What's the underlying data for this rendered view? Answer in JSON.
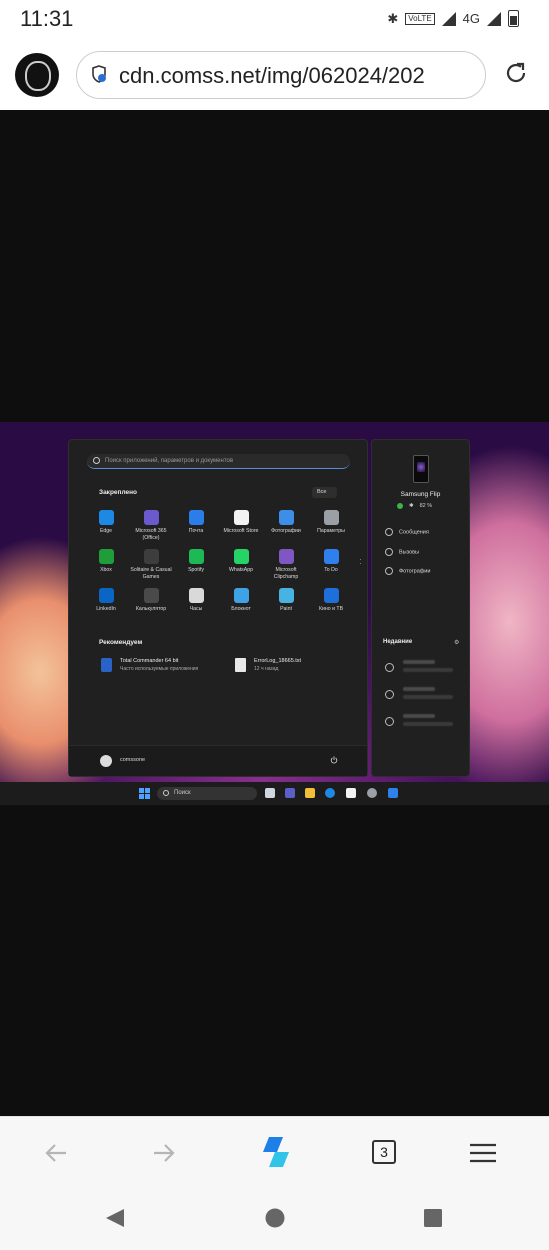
{
  "status_bar": {
    "time": "11:31",
    "volte": "VoLTE",
    "network": "4G"
  },
  "browser": {
    "url": "cdn.comss.net/img/062024/202",
    "tabs_count": "3"
  },
  "start_menu": {
    "search_placeholder": "Поиск приложений, параметров и документов",
    "pinned_title": "Закреплено",
    "all_button": "Все",
    "apps": [
      {
        "label": "Edge",
        "color": "#1e88e5"
      },
      {
        "label": "Microsoft 365 (Office)",
        "color": "#6a5acd"
      },
      {
        "label": "Почта",
        "color": "#2b7de9"
      },
      {
        "label": "Microsoft Store",
        "color": "#f2f2f2"
      },
      {
        "label": "Фотографии",
        "color": "#3d8ee6"
      },
      {
        "label": "Параметры",
        "color": "#9aa0a6"
      },
      {
        "label": "Xbox",
        "color": "#1f9d3a"
      },
      {
        "label": "Solitaire & Casual Games",
        "color": "#3d3d3d"
      },
      {
        "label": "Spotify",
        "color": "#1db954"
      },
      {
        "label": "WhatsApp",
        "color": "#25d366"
      },
      {
        "label": "Microsoft Clipchamp",
        "color": "#7e57c2"
      },
      {
        "label": "To Do",
        "color": "#2f80ed"
      },
      {
        "label": "LinkedIn",
        "color": "#0a66c2"
      },
      {
        "label": "Калькулятор",
        "color": "#4a4a4a"
      },
      {
        "label": "Часы",
        "color": "#d9d9d9"
      },
      {
        "label": "Блокнот",
        "color": "#3fa2e6"
      },
      {
        "label": "Paint",
        "color": "#47b3e0"
      },
      {
        "label": "Кино и ТВ",
        "color": "#1e6fd9"
      }
    ],
    "recommended_title": "Рекомендуем",
    "recommended": [
      {
        "title": "Total Commander 64 bit",
        "subtitle": "Часто используемые приложения",
        "color": "#2a63c8"
      },
      {
        "title": "ErrorLog_18665.txt",
        "subtitle": "12 ч назад",
        "color": "#e8e8e8"
      }
    ],
    "user_name": "comssone"
  },
  "phone_panel": {
    "device_name": "Samsung Flip",
    "battery": "82 %",
    "items": [
      "Сообщения",
      "Вызовы",
      "Фотографии"
    ],
    "recent_title": "Недавние"
  },
  "taskbar": {
    "search_label": "Поиск"
  }
}
